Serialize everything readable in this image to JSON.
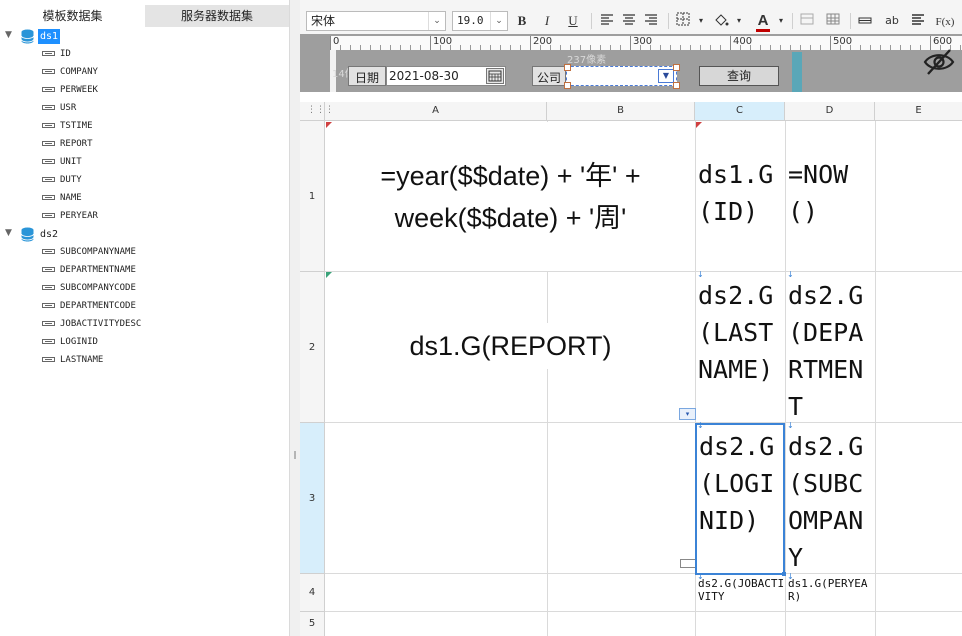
{
  "left_panel": {
    "tabs": [
      "模板数据集",
      "服务器数据集"
    ],
    "datasets": [
      {
        "name": "ds1",
        "fields": [
          "ID",
          "COMPANY",
          "PERWEEK",
          "USR",
          "TSTIME",
          "REPORT",
          "UNIT",
          "DUTY",
          "NAME",
          "PERYEAR"
        ]
      },
      {
        "name": "ds2",
        "fields": [
          "SUBCOMPANYNAME",
          "DEPARTMENTNAME",
          "SUBCOMPANYCODE",
          "DEPARTMENTCODE",
          "JOBACTIVITYDESC",
          "LOGINID",
          "LASTNAME"
        ]
      }
    ]
  },
  "toolbar": {
    "font_family": "宋体",
    "font_size": "19.0",
    "bold_label": "B",
    "italic_label": "I",
    "underline_label": "U",
    "text_color_label": "A",
    "abbr_label": "ab",
    "formula_label": "F(x)",
    "colors": {
      "text_color_bar": "#c00000"
    }
  },
  "param_panel": {
    "ruler_labels": [
      "0",
      "100",
      "200",
      "300",
      "400",
      "500",
      "600"
    ],
    "size_hint_width": "237像素",
    "size_hint_height": "14像素",
    "date_label": "日期",
    "date_value": "2021-08-30",
    "company_label": "公司",
    "company_value": "",
    "query_button": "查询"
  },
  "sheet": {
    "column_headers": [
      "A",
      "B",
      "C",
      "D",
      "E"
    ],
    "row_headers": [
      "1",
      "2",
      "3",
      "4",
      "5"
    ],
    "selected_column": "C",
    "selected_row": "3",
    "cells": {
      "A1": "=year($$date) + '年' + week($$date) + '周'",
      "C1": "ds1.G(ID)",
      "D1": "=NOW()",
      "A2": "ds1.G(REPORT)",
      "C2": "ds2.G(LASTNAME)",
      "D2": "ds2.G(DEPARTMENT",
      "C3": "ds2.G(LOGINID)",
      "D3": "ds2.G(SUBCOMPANY",
      "C4": "ds2.G(JOBACTIVITY",
      "D4": "ds1.G(PERYEAR)"
    }
  }
}
